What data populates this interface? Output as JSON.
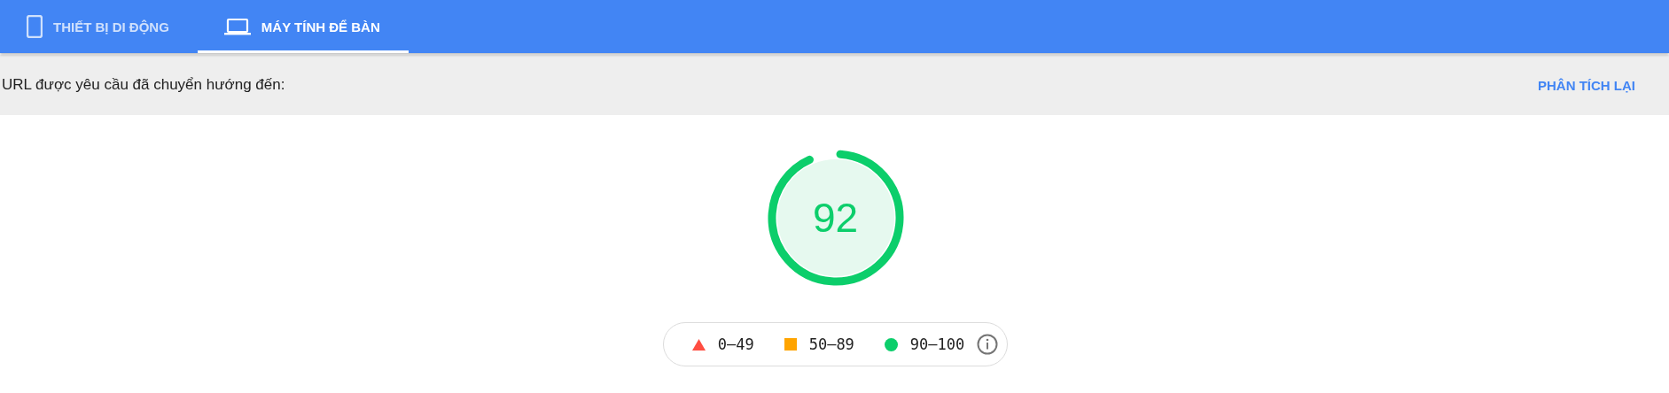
{
  "tabs": [
    {
      "label": "THIẾT BỊ DI ĐỘNG",
      "kind": "phone",
      "selected": false
    },
    {
      "label": "MÁY TÍNH ĐỂ BÀN",
      "kind": "laptop",
      "selected": true
    }
  ],
  "redirect_bar": {
    "text": "URL được yêu cầu đã chuyển hướng đến:",
    "action": "PHÂN TÍCH LẠI"
  },
  "score": {
    "value": "92",
    "level": 0.92
  },
  "legend": [
    {
      "kind": "triangle",
      "color": "#ff4e42",
      "label": "0–49"
    },
    {
      "kind": "square",
      "color": "#ffa400",
      "label": "50–89"
    },
    {
      "kind": "circle",
      "color": "#0cce6b",
      "label": "90–100"
    }
  ]
}
